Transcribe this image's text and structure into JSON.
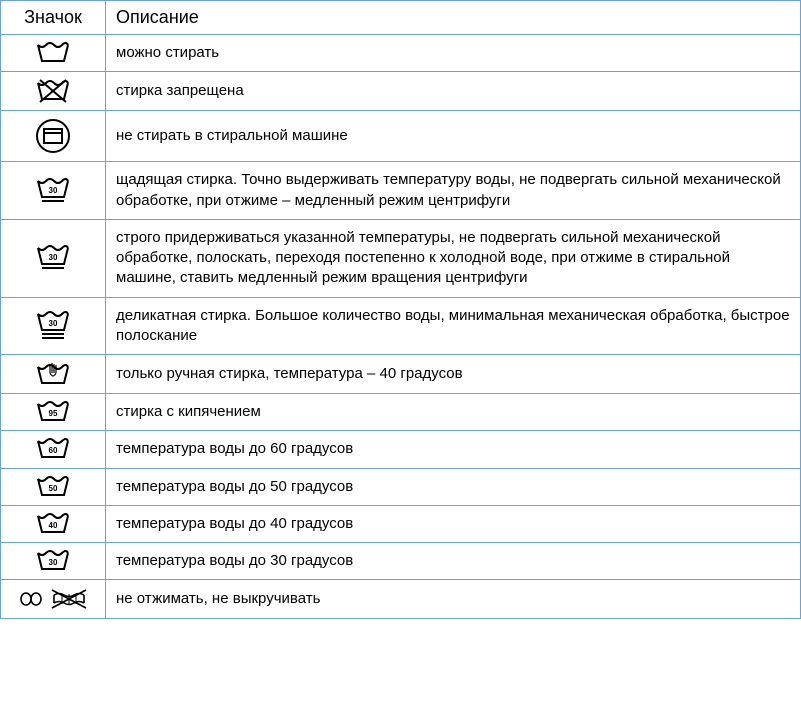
{
  "headers": {
    "icon": "Значок",
    "description": "Описание"
  },
  "rows": [
    {
      "icon": "wash",
      "description": "можно стирать"
    },
    {
      "icon": "wash-no",
      "description": "стирка запрещена"
    },
    {
      "icon": "no-machine",
      "description": "не стирать в стиральной машине"
    },
    {
      "icon": "wash-gentle-30",
      "description": "щадящая стирка. Точно выдерживать температуру воды, не подвергать сильной механической обработке, при отжиме – медленный режим центрифуги"
    },
    {
      "icon": "wash-strict-30",
      "description": "строго придерживаться указанной температуры, не подвергать сильной механической обработке, полоскать, переходя постепенно к холодной воде, при отжиме в стиральной машине, ставить медленный режим вращения центрифуги"
    },
    {
      "icon": "wash-delicate-30",
      "description": "деликатная стирка. Большое количество воды, минимальная механическая обработка, быстрое полоскание"
    },
    {
      "icon": "hand-wash",
      "description": "только ручная стирка, температура – 40 градусов"
    },
    {
      "icon": "wash-95",
      "description": "стирка с кипячением"
    },
    {
      "icon": "wash-60",
      "description": "температура воды до 60 градусов"
    },
    {
      "icon": "wash-50",
      "description": "температура воды до 50 градусов"
    },
    {
      "icon": "wash-40",
      "description": "температура воды до 40 градусов"
    },
    {
      "icon": "wash-30",
      "description": "температура воды до 30 градусов"
    },
    {
      "icon": "no-wring",
      "description": "не отжимать, не выкручивать"
    }
  ],
  "icon_labels": {
    "wash-gentle-30": "30",
    "wash-strict-30": "30",
    "wash-delicate-30": "30",
    "wash-95": "95",
    "wash-60": "60",
    "wash-50": "50",
    "wash-40": "40",
    "wash-30": "30"
  }
}
